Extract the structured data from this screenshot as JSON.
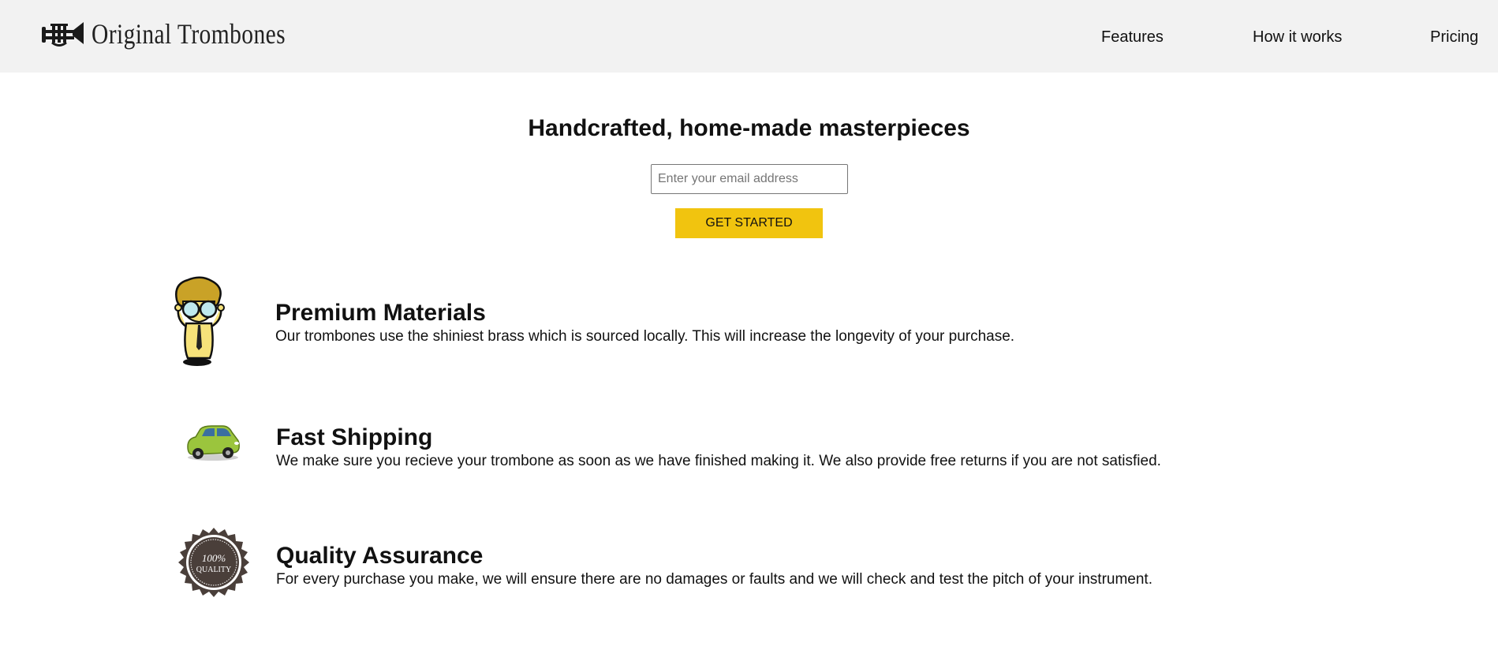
{
  "header": {
    "logo_text": "Original Trombones",
    "logo_icon": "trombone-icon",
    "nav": [
      {
        "label": "Features"
      },
      {
        "label": "How it works"
      },
      {
        "label": "Pricing"
      }
    ],
    "background": "#f2f2f2"
  },
  "hero": {
    "title": "Handcrafted, home-made masterpieces",
    "email_placeholder": "Enter your email address",
    "email_value": "",
    "cta_label": "GET STARTED",
    "cta_color": "#f1c40f"
  },
  "features": [
    {
      "icon": "scientist-icon",
      "title": "Premium Materials",
      "text": "Our trombones use the shiniest brass which is sourced locally. This will increase the longevity of your purchase."
    },
    {
      "icon": "car-icon",
      "title": "Fast Shipping",
      "text": "We make sure you recieve your trombone as soon as we have finished making it. We also provide free returns if you are not satisfied."
    },
    {
      "icon": "quality-seal-icon",
      "title": "Quality Assurance",
      "text": "For every purchase you make, we will ensure there are no damages or faults and we will check and test the pitch of your instrument.",
      "seal_text": [
        "100%",
        "QUALITY"
      ]
    }
  ]
}
